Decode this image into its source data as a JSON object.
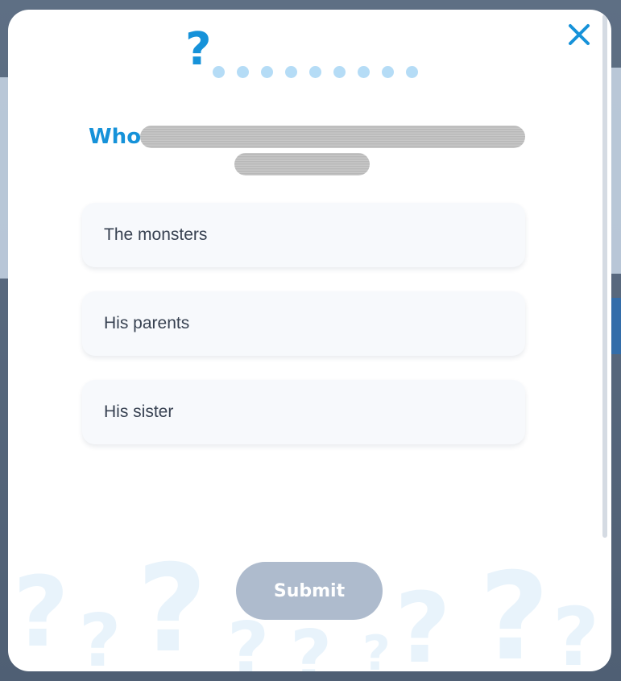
{
  "question": {
    "text": "Who"
  },
  "options": [
    {
      "label": "The monsters"
    },
    {
      "label": "His parents"
    },
    {
      "label": "His sister"
    }
  ],
  "submit": {
    "label": "Submit"
  },
  "progress": {
    "total_dots": 9,
    "current_marker_icon": "question-mark-icon"
  },
  "icons": {
    "close": "close-icon",
    "progress_marker": "question-mark-icon"
  },
  "colors": {
    "accent": "#1692d9",
    "dot": "#b5dcf6",
    "submit_disabled": "#aebbcd",
    "option_bg": "#f7f9fc"
  }
}
